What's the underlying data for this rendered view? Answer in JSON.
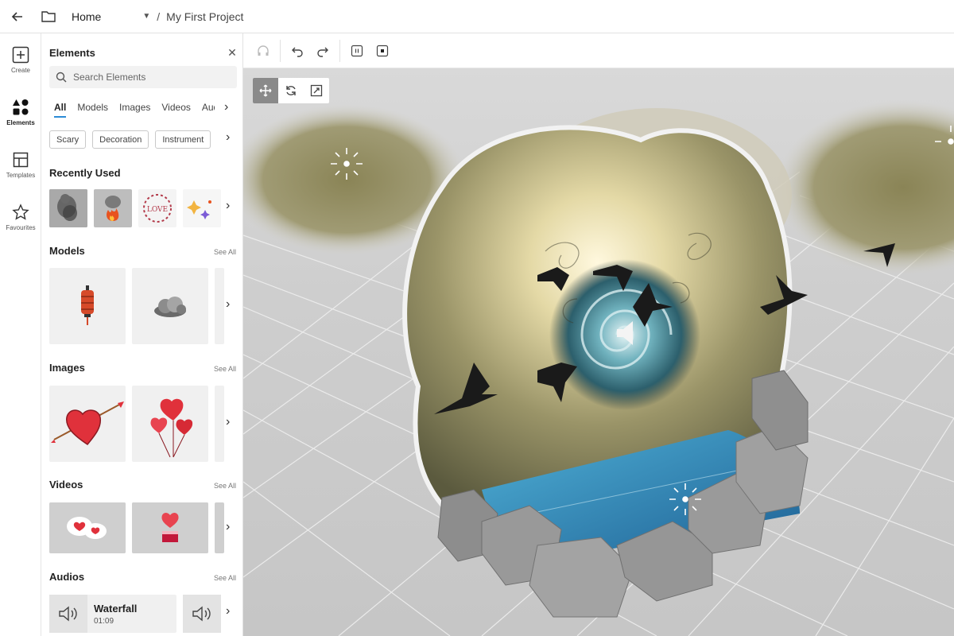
{
  "topbar": {
    "home_label": "Home",
    "separator": "/",
    "project_name": "My First Project"
  },
  "rail": {
    "items": [
      {
        "label": "Create",
        "icon": "plus-square-icon"
      },
      {
        "label": "Elements",
        "icon": "shapes-icon",
        "active": true
      },
      {
        "label": "Templates",
        "icon": "layout-icon"
      },
      {
        "label": "Favourites",
        "icon": "star-icon"
      }
    ]
  },
  "panel": {
    "title": "Elements",
    "search_placeholder": "Search Elements",
    "tabs": [
      "All",
      "Models",
      "Images",
      "Videos",
      "Audios"
    ],
    "active_tab": "All",
    "chips": [
      "Scary",
      "Decoration",
      "Instrument"
    ],
    "recently_used": {
      "title": "Recently Used"
    },
    "models": {
      "title": "Models",
      "see_all": "See All"
    },
    "images": {
      "title": "Images",
      "see_all": "See All"
    },
    "videos": {
      "title": "Videos",
      "see_all": "See All"
    },
    "audios": {
      "title": "Audios",
      "see_all": "See All",
      "items": [
        {
          "name": "Waterfall",
          "duration": "01:09"
        }
      ]
    },
    "love_badge": "LOVE"
  },
  "colors": {
    "accent": "#2c8bd6",
    "gizmo_active": "#8a8a8a",
    "heart_red": "#e0313b",
    "water_blue": "#1d6fa8"
  }
}
